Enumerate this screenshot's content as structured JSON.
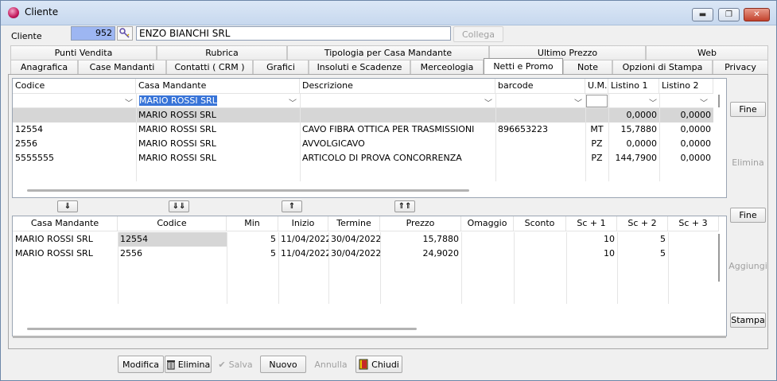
{
  "window": {
    "title": "Cliente"
  },
  "header": {
    "cliente_label": "Cliente",
    "cliente_code": "952",
    "cliente_name": "ENZO BIANCHI SRL",
    "collega_label": "Collega"
  },
  "tabs_row1": [
    "Punti Vendita",
    "Rubrica",
    "Tipologia per Casa Mandante",
    "Ultimo Prezzo",
    "Web"
  ],
  "tabs_row2": [
    "Anagrafica",
    "Case Mandanti",
    "Contatti ( CRM )",
    "Grafici",
    "Insoluti e Scadenze",
    "Merceologia",
    "Netti e Promo",
    "Note",
    "Opzioni di Stampa",
    "Privacy"
  ],
  "active_tab": "Netti e Promo",
  "upper_grid": {
    "columns": [
      "Codice",
      "Casa Mandante",
      "Descrizione",
      "barcode",
      "U.M.",
      "Listino 1",
      "Listino 2"
    ],
    "filter_value": "MARIO ROSSI SRL",
    "rows": [
      [
        "",
        "MARIO ROSSI SRL",
        "",
        "",
        "",
        "0,0000",
        "0,0000"
      ],
      [
        "12554",
        "MARIO ROSSI SRL",
        "CAVO FIBRA OTTICA PER TRASMISSIONI",
        "896653223",
        "MT",
        "15,7880",
        "0,0000"
      ],
      [
        "2556",
        "MARIO ROSSI SRL",
        "AVVOLGICAVO",
        "",
        "PZ",
        "0,0000",
        "0,0000"
      ],
      [
        "5555555",
        "MARIO ROSSI SRL",
        "ARTICOLO DI PROVA CONCORRENZA",
        "",
        "PZ",
        "144,7900",
        "0,0000"
      ]
    ]
  },
  "move_buttons": [
    "⇓",
    "⇓⇓",
    "⇑",
    "⇑⇑"
  ],
  "lower_grid": {
    "columns": [
      "Casa Mandante",
      "Codice",
      "Min",
      "Inizio",
      "Termine",
      "Prezzo",
      "Omaggio",
      "Sconto",
      "Sc + 1",
      "Sc + 2",
      "Sc + 3"
    ],
    "rows": [
      [
        "MARIO ROSSI SRL",
        "12554",
        "5",
        "11/04/2022",
        "30/04/2022",
        "15,7880",
        "",
        "",
        "10",
        "5",
        ""
      ],
      [
        "MARIO ROSSI SRL",
        "2556",
        "5",
        "11/04/2022",
        "30/04/2022",
        "24,9020",
        "",
        "",
        "10",
        "5",
        ""
      ]
    ]
  },
  "side_buttons": {
    "fine1": "Fine",
    "elimina": "Elimina",
    "fine2": "Fine",
    "aggiungi": "Aggiungi",
    "stampa": "Stampa"
  },
  "footer": {
    "modifica": "Modifica",
    "elimina": "Elimina",
    "salva": "Salva",
    "nuovo": "Nuovo",
    "annulla": "Annulla",
    "chiudi": "Chiudi"
  }
}
